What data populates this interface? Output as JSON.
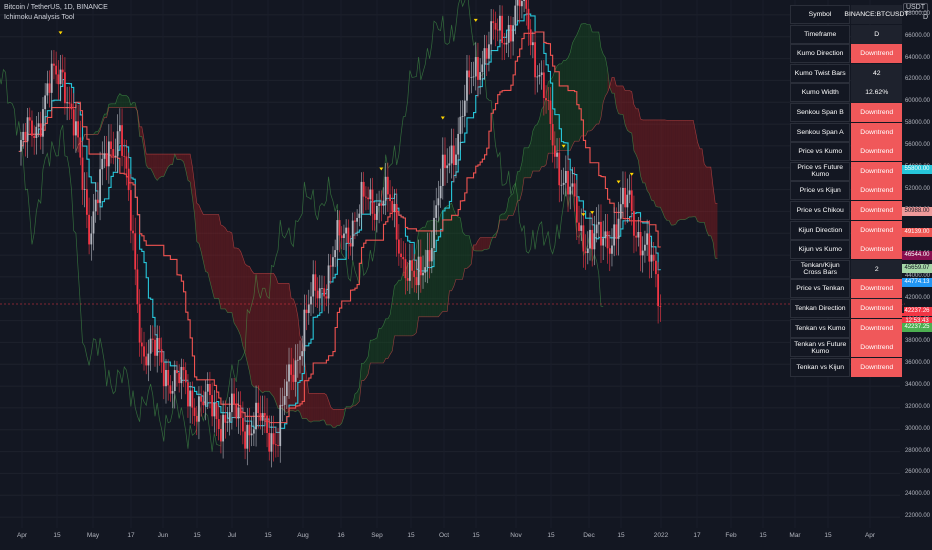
{
  "header": {
    "symbol_line": "Bitcoin / TetherUS, 1D, BINANCE",
    "indicator_name": "Ichimoku Analysis Tool",
    "currency_badge": "USDT",
    "unit_label": "D"
  },
  "price_axis": {
    "ticks": [
      "68000.00",
      "66000.00",
      "64000.00",
      "62000.00",
      "60000.00",
      "58000.00",
      "56000.00",
      "54000.00",
      "52000.00",
      "50000.00",
      "48000.00",
      "46000.00",
      "44000.00",
      "42000.00",
      "40000.00",
      "38000.00",
      "36000.00",
      "34000.00",
      "32000.00",
      "30000.00",
      "28000.00",
      "26000.00",
      "24000.00",
      "22000.00"
    ],
    "labels": [
      {
        "text": "55800.00",
        "color": "#26c6da"
      },
      {
        "text": "50988.00",
        "color": "#ef9a9a"
      },
      {
        "text": "49139.00",
        "color": "#ef5350"
      },
      {
        "text": "46544.00",
        "color": "#880e4f"
      },
      {
        "text": "45659.07",
        "color": "#a5d6a7"
      },
      {
        "text": "44774.13",
        "color": "#2196f3"
      },
      {
        "text": "42237.26",
        "color": "#f23645"
      },
      {
        "text": "12:53:43",
        "color": "#f23645"
      },
      {
        "text": "42237.25",
        "color": "#4caf50"
      }
    ],
    "symbol_tag": "BTCUSDT"
  },
  "time_axis": [
    "Apr",
    "15",
    "May",
    "17",
    "Jun",
    "15",
    "Jul",
    "15",
    "Aug",
    "16",
    "Sep",
    "15",
    "Oct",
    "15",
    "Nov",
    "15",
    "Dec",
    "15",
    "2022",
    "17",
    "Feb",
    "15",
    "Mar",
    "15",
    "Apr"
  ],
  "table": {
    "rows": [
      {
        "label": "Symbol",
        "value": "BINANCE:BTCUSDT",
        "status": "neutral"
      },
      {
        "label": "Timeframe",
        "value": "D",
        "status": "neutral"
      },
      {
        "label": "Kumo Direction",
        "value": "Downtrend",
        "status": "down"
      },
      {
        "label": "Kumo Twist Bars",
        "value": "42",
        "status": "neutral"
      },
      {
        "label": "Kumo Width",
        "value": "12.62%",
        "status": "neutral"
      },
      {
        "label": "Senkou Span B",
        "value": "Downtrend",
        "status": "down"
      },
      {
        "label": "Senkou Span A",
        "value": "Downtrend",
        "status": "down"
      },
      {
        "label": "Price vs Kumo",
        "value": "Downtrend",
        "status": "down"
      },
      {
        "label": "Price vs Future Kumo",
        "value": "Downtrend",
        "status": "down"
      },
      {
        "label": "Price vs Kijun",
        "value": "Downtrend",
        "status": "down"
      },
      {
        "label": "Price vs Chikou",
        "value": "Downtrend",
        "status": "down"
      },
      {
        "label": "Kijun Direction",
        "value": "Downtrend",
        "status": "down"
      },
      {
        "label": "Kijun vs Kumo",
        "value": "Downtrend",
        "status": "down"
      },
      {
        "label": "Tenkan/Kijun Cross Bars",
        "value": "2",
        "status": "neutral"
      },
      {
        "label": "Price vs Tenkan",
        "value": "Downtrend",
        "status": "down"
      },
      {
        "label": "Tenkan Direction",
        "value": "Downtrend",
        "status": "down"
      },
      {
        "label": "Tenkan vs Kumo",
        "value": "Downtrend",
        "status": "down"
      },
      {
        "label": "Tenkan vs Future Kumo",
        "value": "Downtrend",
        "status": "down"
      },
      {
        "label": "Tenkan vs Kijun",
        "value": "Downtrend",
        "status": "down"
      }
    ]
  },
  "chart_data": {
    "type": "line",
    "ylim": [
      21000,
      69000
    ],
    "series": [
      {
        "x": [
          "2021-03-24",
          "2021-04-13",
          "2021-04-25",
          "2021-05-09",
          "2021-05-19",
          "2021-06-08",
          "2021-06-22",
          "2021-07-20",
          "2021-08-01",
          "2021-08-23",
          "2021-09-06",
          "2021-09-21",
          "2021-10-06",
          "2021-10-20",
          "2021-11-10",
          "2021-11-20",
          "2021-12-04",
          "2021-12-14",
          "2021-12-27",
          "2022-01-10"
        ],
        "values": [
          55000,
          63500,
          49000,
          58500,
          38000,
          33500,
          31500,
          29800,
          40000,
          49500,
          51800,
          42500,
          55000,
          64500,
          68800,
          58000,
          48500,
          46800,
          50800,
          42200
        ]
      }
    ],
    "colors": {
      "tenkan": "#26c6da",
      "kijun": "#ef5350",
      "chikou": "#4caf50",
      "cloud_bull": "#1b5e20",
      "cloud_bear": "#b71c1c",
      "marker": "#ffd600"
    }
  }
}
